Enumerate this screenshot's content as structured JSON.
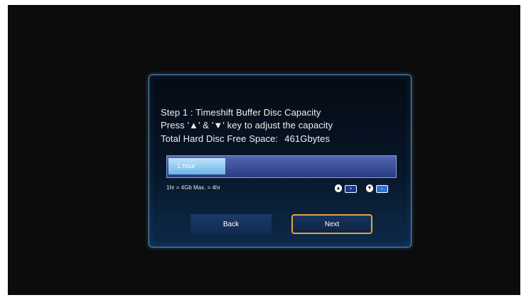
{
  "dialog": {
    "title": "Step 1 : Timeshift Buffer Disc Capacity",
    "instruction": "Press '▲' & '▼' key to adjust the capacity",
    "free_space_label": "Total Hard Disc Free Space:",
    "free_space_value": "461Gbytes"
  },
  "capacity_bar": {
    "value_label": "1 hour",
    "fill_fraction": 0.25,
    "scale_text": "1hr = 4Gb  Max. = 4hr"
  },
  "key_hints": [
    {
      "icon": "up-arrow-icon",
      "glyph": "▲",
      "target": "increase-icon",
      "target_glyph": "+"
    },
    {
      "icon": "down-arrow-icon",
      "glyph": "▼",
      "target": "decrease-icon",
      "target_glyph": "−"
    }
  ],
  "buttons": {
    "back_label": "Back",
    "next_label": "Next"
  },
  "colors": {
    "focus_border": "#e8a23a",
    "dialog_border": "#5a8fb8",
    "bar_fill": "#8ccbf2",
    "bar_track": "#3a4c9a"
  }
}
